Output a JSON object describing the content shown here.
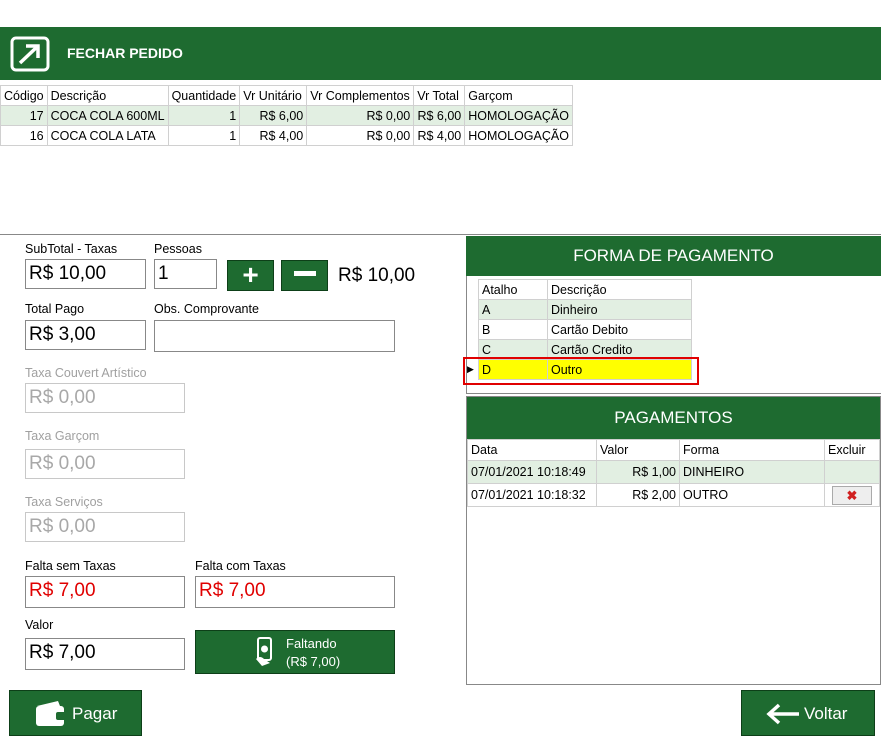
{
  "header": {
    "title": "FECHAR PEDIDO",
    "icon": "exit-arrow-icon"
  },
  "order_table": {
    "columns": [
      "Código",
      "Descrição",
      "Quantidade",
      "Vr Unitário",
      "Vr Complementos",
      "Vr Total",
      "Garçom"
    ],
    "rows": [
      [
        "17",
        "COCA COLA 600ML",
        "1",
        "R$ 6,00",
        "R$ 0,00",
        "R$ 6,00",
        "HOMOLOGAÇÃO"
      ],
      [
        "16",
        "COCA COLA LATA",
        "1",
        "R$ 4,00",
        "R$ 0,00",
        "R$ 4,00",
        "HOMOLOGAÇÃO"
      ]
    ]
  },
  "form": {
    "subtotal_label": "SubTotal - Taxas",
    "subtotal_value": "R$ 10,00",
    "pessoas_label": "Pessoas",
    "pessoas_value": "1",
    "per_person_value": "R$ 10,00",
    "total_pago_label": "Total Pago",
    "total_pago_value": "R$ 3,00",
    "obs_label": "Obs. Comprovante",
    "obs_value": "",
    "couvert_label": "Taxa Couvert Artístico",
    "couvert_value": "R$ 0,00",
    "garcom_label": "Taxa Garçom",
    "garcom_value": "R$ 0,00",
    "servicos_label": "Taxa Serviços",
    "servicos_value": "R$ 0,00",
    "falta_sem_label": "Falta sem Taxas",
    "falta_sem_value": "R$ 7,00",
    "falta_com_label": "Falta com Taxas",
    "falta_com_value": "R$ 7,00",
    "valor_label": "Valor",
    "valor_value": "R$ 7,00",
    "faltando_label": "Faltando",
    "faltando_value": "(R$ 7,00)"
  },
  "forma_pagamento": {
    "title": "FORMA DE PAGAMENTO",
    "columns": [
      "Atalho",
      "Descrição"
    ],
    "rows": [
      [
        "A",
        "Dinheiro"
      ],
      [
        "B",
        "Cartão Debito"
      ],
      [
        "C",
        "Cartão Credito"
      ],
      [
        "D",
        "Outro"
      ]
    ],
    "selected_index": 3
  },
  "pagamentos": {
    "title": "PAGAMENTOS",
    "columns": [
      "Data",
      "Valor",
      "Forma",
      "Excluir"
    ],
    "rows": [
      [
        "07/01/2021 10:18:49",
        "R$ 1,00",
        "DINHEIRO"
      ],
      [
        "07/01/2021 10:18:32",
        "R$ 2,00",
        "OUTRO"
      ]
    ]
  },
  "buttons": {
    "pagar": "Pagar",
    "voltar": "Voltar"
  },
  "colors": {
    "brand_green": "#1e6b30",
    "row_green": "#e2efe2",
    "selected_yellow": "#ffff00",
    "highlight_red": "#e00000"
  }
}
